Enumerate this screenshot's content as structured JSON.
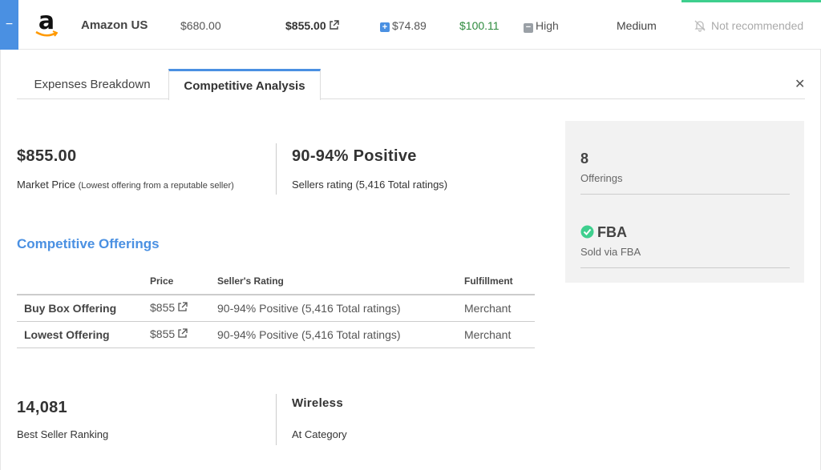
{
  "row": {
    "collapse_symbol": "−",
    "store_name": "Amazon US",
    "cost_price": "$680.00",
    "market_price": "$855.00",
    "fees": "$74.89",
    "profit": "$100.11",
    "demand": "High",
    "competition": "Medium",
    "recommendation": "Not recommended",
    "colors": {
      "accent": "#4a90e2",
      "profit": "#2e8b3e",
      "top_bar": "#3ecf8e"
    }
  },
  "tabs": [
    {
      "label": "Expenses Breakdown",
      "active": false
    },
    {
      "label": "Competitive Analysis",
      "active": true
    }
  ],
  "close_symbol": "✕",
  "market": {
    "value": "$855.00",
    "label": "Market Price",
    "note": "(Lowest offering from a reputable seller)"
  },
  "sellers": {
    "value": "90-94% Positive",
    "label": "Sellers rating (5,416 Total ratings)"
  },
  "offerings_section": {
    "title": "Competitive Offerings",
    "headers": [
      "",
      "Price",
      "Seller's Rating",
      "Fulfillment"
    ],
    "rows": [
      {
        "label": "Buy Box Offering",
        "price": "$855",
        "rating": "90-94% Positive (5,416 Total ratings)",
        "fulfillment": "Merchant"
      },
      {
        "label": "Lowest Offering",
        "price": "$855",
        "rating": "90-94% Positive (5,416 Total ratings)",
        "fulfillment": "Merchant"
      }
    ]
  },
  "ranking": {
    "value": "14,081",
    "label": "Best Seller Ranking"
  },
  "category": {
    "value": "Wireless",
    "label": "At Category"
  },
  "side": {
    "offerings_count": "8",
    "offerings_label": "Offerings",
    "fba_value": "FBA",
    "fba_label": "Sold via FBA"
  }
}
